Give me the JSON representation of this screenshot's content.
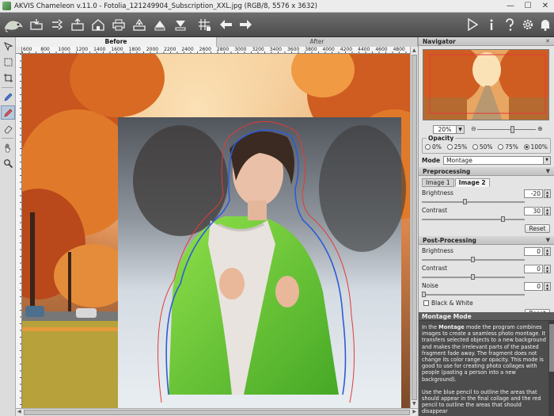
{
  "window": {
    "title": "AKVIS Chameleon v.11.0 - Fotolia_121249904_Subscription_XXL.jpg (RGB/8, 5576 x 3632)",
    "minimize": "—",
    "maximize": "☐",
    "close": "✕"
  },
  "toolbar": {
    "left": [
      "open-icon",
      "save-icon",
      "batch-icon",
      "home-icon",
      "print-icon",
      "share-icon",
      "upload-icon",
      "download-icon",
      "grid-icon",
      "back-arrow-icon",
      "forward-arrow-icon"
    ],
    "right": [
      "play-icon",
      "info-icon",
      "help-icon",
      "settings-icon",
      "bell-icon"
    ]
  },
  "tools": [
    "select-tool",
    "rect-select-tool",
    "crop-tool",
    "keep-pencil-tool",
    "remove-pencil-tool",
    "eraser-tool",
    "hand-tool",
    "zoom-tool"
  ],
  "tabs": {
    "before": "Before",
    "after": "After"
  },
  "ruler": {
    "h_ticks": [
      "600",
      "800",
      "1000",
      "1200",
      "1400",
      "1600",
      "1800",
      "2000",
      "2200",
      "2400",
      "2600",
      "2800",
      "3000",
      "3200",
      "3400",
      "3600",
      "3800",
      "4000",
      "4200",
      "4400",
      "4600",
      "4800"
    ]
  },
  "navigator": {
    "title": "Navigator",
    "zoom": "20%",
    "zoom_minus": "⊖",
    "zoom_plus": "⊕"
  },
  "opacity": {
    "title": "Opacity",
    "options": [
      "0%",
      "25%",
      "50%",
      "75%",
      "100%"
    ],
    "selected": "100%"
  },
  "mode": {
    "label": "Mode",
    "value": "Montage"
  },
  "preprocessing": {
    "title": "Preprocessing",
    "tabs": [
      "Image 1",
      "Image 2"
    ],
    "active_tab": "Image 2",
    "brightness_label": "Brightness",
    "brightness": "-20",
    "contrast_label": "Contrast",
    "contrast": "30",
    "reset": "Reset"
  },
  "postprocessing": {
    "title": "Post-Processing",
    "brightness_label": "Brightness",
    "brightness": "0",
    "contrast_label": "Contrast",
    "contrast": "0",
    "noise_label": "Noise",
    "noise": "0",
    "bw_label": "Black & White",
    "reset": "Reset"
  },
  "help": {
    "title": "Montage Mode",
    "p1_prefix": "In the ",
    "p1_bold": "Montage",
    "p1_rest": " mode the program combines images to create a seamless photo montage. It transfers selected objects to a new background and makes the irrelevant parts of the pasted fragment fade away. The fragment does not change its color range or opacity. This mode is good to use for creating photo collages with people (pasting a person into a new background).",
    "p2": "Use the blue pencil to outline the areas that should appear in the final collage and the red pencil to outline the areas that should disappear"
  },
  "colors": {
    "keep_outline": "#2f5bd6",
    "remove_outline": "#e23a3a",
    "panel_bg": "#e4e4e4",
    "toolbar_bg": "#555555"
  }
}
